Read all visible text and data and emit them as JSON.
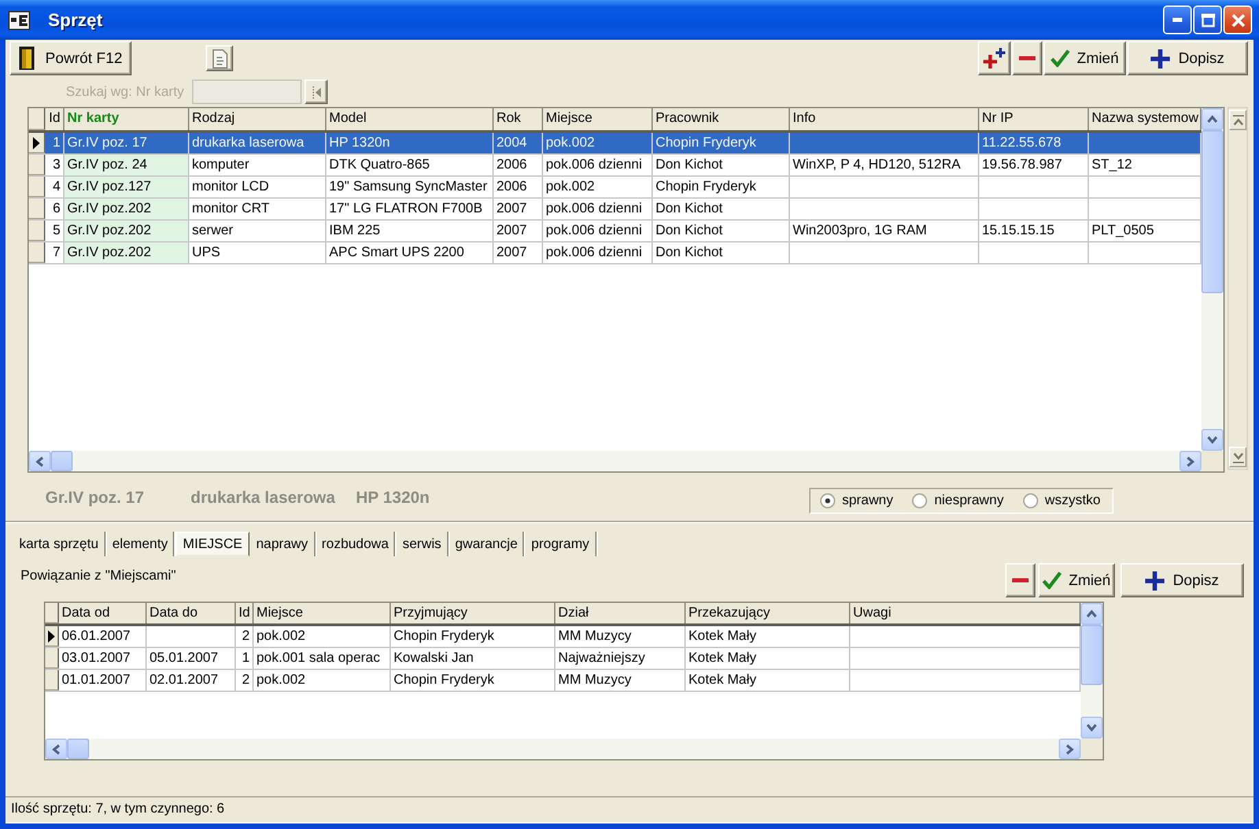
{
  "window": {
    "title": "Sprzęt"
  },
  "toolbar": {
    "back_button": "Powrót F12",
    "actions": [
      {
        "kind": "add-many"
      },
      {
        "kind": "remove"
      },
      {
        "kind": "edit",
        "label": "Zmień"
      },
      {
        "kind": "add",
        "label": "Dopisz"
      }
    ]
  },
  "search": {
    "label": "Szukaj wg: Nr karty",
    "disabled": true
  },
  "equipment_table": {
    "columns": [
      {
        "label": "Id",
        "kind": "number",
        "highlighted": false
      },
      {
        "label": "Nr karty",
        "kind": "text",
        "highlighted": true
      },
      {
        "label": "Rodzaj",
        "kind": "text",
        "highlighted": false
      },
      {
        "label": "Model",
        "kind": "text",
        "highlighted": false
      },
      {
        "label": "Rok",
        "kind": "text",
        "highlighted": false
      },
      {
        "label": "Miejsce",
        "kind": "text",
        "highlighted": false
      },
      {
        "label": "Pracownik",
        "kind": "text",
        "highlighted": false
      },
      {
        "label": "Info",
        "kind": "text",
        "highlighted": false
      },
      {
        "label": "Nr IP",
        "kind": "text",
        "highlighted": false
      },
      {
        "label": "Nazwa systemow",
        "kind": "text",
        "highlighted": false
      }
    ],
    "rows": [
      {
        "selected": true,
        "cells": [
          "1",
          "Gr.IV poz. 17",
          "drukarka laserowa",
          "HP 1320n",
          "2004",
          "pok.002",
          "Chopin Fryderyk",
          null,
          "11.22.55.678",
          null
        ]
      },
      {
        "selected": false,
        "cells": [
          "3",
          "Gr.IV poz. 24",
          "komputer",
          "DTK Quatro-865",
          "2006",
          "pok.006 dzienni",
          "Don Kichot",
          "WinXP, P 4, HD120, 512RA",
          "19.56.78.987",
          "ST_12"
        ]
      },
      {
        "selected": false,
        "cells": [
          "4",
          "Gr.IV poz.127",
          "monitor LCD",
          "19\" Samsung SyncMaster",
          "2006",
          "pok.002",
          "Chopin Fryderyk",
          null,
          null,
          null
        ]
      },
      {
        "selected": false,
        "cells": [
          "6",
          "Gr.IV poz.202",
          "monitor CRT",
          "17\" LG FLATRON F700B",
          "2007",
          "pok.006 dzienni",
          "Don Kichot",
          null,
          null,
          null
        ]
      },
      {
        "selected": false,
        "cells": [
          "5",
          "Gr.IV poz.202",
          "serwer",
          "IBM 225",
          "2007",
          "pok.006 dzienni",
          "Don Kichot",
          "Win2003pro, 1G RAM",
          "15.15.15.15",
          "PLT_0505"
        ]
      },
      {
        "selected": false,
        "cells": [
          "7",
          "Gr.IV poz.202",
          "UPS",
          "APC Smart UPS 2200",
          "2007",
          "pok.006 dzienni",
          "Don Kichot",
          null,
          null,
          null
        ]
      }
    ]
  },
  "record_summary": [
    "Gr.IV poz. 17",
    "drukarka laserowa",
    "HP 1320n"
  ],
  "status_filter": [
    {
      "label": "sprawny",
      "selected": true
    },
    {
      "label": "niesprawny",
      "selected": false
    },
    {
      "label": "wszystko",
      "selected": false
    }
  ],
  "tabs": [
    {
      "label": "karta sprzętu",
      "selected": false
    },
    {
      "label": "elementy",
      "selected": false
    },
    {
      "label": "MIEJSCE",
      "selected": true
    },
    {
      "label": "naprawy",
      "selected": false
    },
    {
      "label": "rozbudowa",
      "selected": false
    },
    {
      "label": "serwis",
      "selected": false
    },
    {
      "label": "gwarancje",
      "selected": false
    },
    {
      "label": "programy",
      "selected": false
    }
  ],
  "location_panel": {
    "caption": "Powiązanie z \"Miejscami\"",
    "actions": [
      {
        "kind": "remove"
      },
      {
        "kind": "edit",
        "label": "Zmień"
      },
      {
        "kind": "add",
        "label": "Dopisz"
      }
    ],
    "table": {
      "columns": [
        {
          "label": "Data od",
          "kind": "text"
        },
        {
          "label": "Data do",
          "kind": "text"
        },
        {
          "label": "Id",
          "kind": "number"
        },
        {
          "label": "Miejsce",
          "kind": "text"
        },
        {
          "label": "Przyjmujący",
          "kind": "text"
        },
        {
          "label": "Dział",
          "kind": "text"
        },
        {
          "label": "Przekazujący",
          "kind": "text"
        },
        {
          "label": "Uwagi",
          "kind": "text"
        }
      ],
      "rows": [
        {
          "selected": true,
          "cells": [
            "06.01.2007",
            null,
            "2",
            "pok.002",
            "Chopin Fryderyk",
            "MM Muzycy",
            "Kotek Mały",
            null
          ]
        },
        {
          "selected": false,
          "cells": [
            "03.01.2007",
            "05.01.2007",
            "1",
            "pok.001 sala operac",
            "Kowalski Jan",
            "Najważniejszy",
            "Kotek Mały",
            null
          ]
        },
        {
          "selected": false,
          "cells": [
            "01.01.2007",
            "02.01.2007",
            "2",
            "pok.002",
            "Chopin Fryderyk",
            "MM Muzycy",
            "Kotek Mały",
            null
          ]
        }
      ]
    }
  },
  "status_bar": "Ilość sprzętu: 7, w tym czynnego: 6"
}
